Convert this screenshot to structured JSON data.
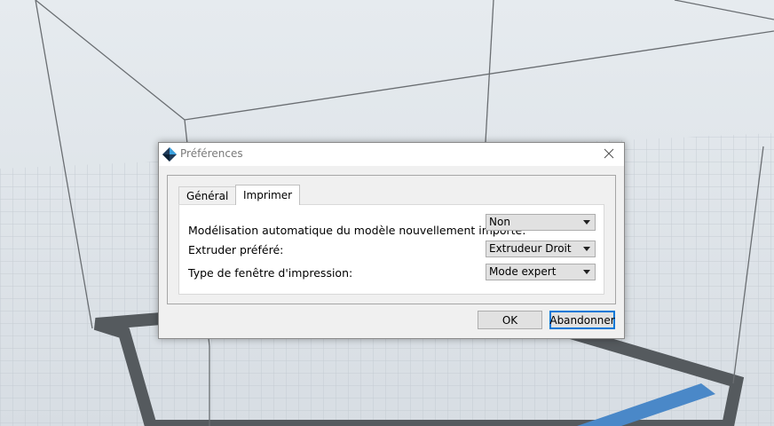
{
  "dialog": {
    "title": "Préférences",
    "icon": "app-logo-icon",
    "close_icon": "close-icon"
  },
  "tabs": [
    {
      "label": "Général",
      "active": false
    },
    {
      "label": "Imprimer",
      "active": true
    }
  ],
  "settings": [
    {
      "label": "Modélisation automatique du modèle nouvellement importé:",
      "value": "Non"
    },
    {
      "label": "Extruder préféré:",
      "value": "Extrudeur Droit"
    },
    {
      "label": "Type de fenêtre d'impression:",
      "value": "Mode expert"
    }
  ],
  "buttons": {
    "ok": "OK",
    "cancel": "Abandonner"
  },
  "colors": {
    "accent": "#0078d7",
    "bed_border": "#555a5e",
    "bed_highlight": "#4a88c8",
    "grid_line": "#c5cbd2"
  }
}
